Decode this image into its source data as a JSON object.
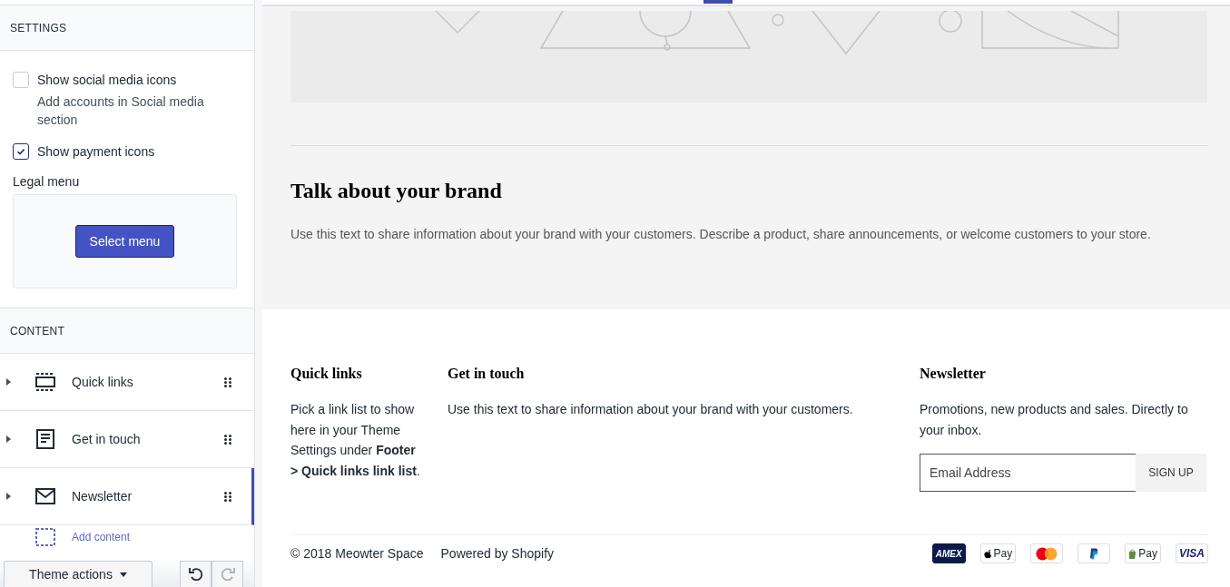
{
  "sidebar": {
    "settings_heading": "SETTINGS",
    "checkboxes": [
      {
        "label": "Show social media icons",
        "checked": false,
        "help": "Add accounts in Social media section"
      },
      {
        "label": "Show payment icons",
        "checked": true
      }
    ],
    "legal_menu": {
      "label": "Legal menu",
      "button": "Select menu"
    },
    "content_heading": "CONTENT",
    "blocks": [
      {
        "kind": "links",
        "label": "Quick links",
        "selected": false
      },
      {
        "kind": "text",
        "label": "Get in touch",
        "selected": false
      },
      {
        "kind": "mail",
        "label": "Newsletter",
        "selected": true
      }
    ],
    "add_content": "Add content",
    "theme_actions": "Theme actions"
  },
  "preview": {
    "heading": "Talk about your brand",
    "text": "Use this text to share information about your brand with your customers. Describe a product, share announcements, or welcome customers to your store.",
    "footer_columns": [
      {
        "title": "Quick links",
        "text": "Pick a link list to show here in your Theme Settings under **Footer > Quick links link list**."
      },
      {
        "title": "Get in touch",
        "text": "Use this text to share information about your brand with your customers."
      }
    ],
    "newsletter": {
      "title": "Newsletter",
      "text": "Promotions, new products and sales. Directly to your inbox.",
      "placeholder": "Email Address",
      "button": "SIGN UP"
    },
    "copyright": "© 2018 Meowter Space",
    "powered": "Powered by Shopify",
    "payment_icons": [
      {
        "kind": "amex",
        "label": "AMEX"
      },
      {
        "kind": "apple",
        "label": "Pay"
      },
      {
        "kind": "mastercard"
      },
      {
        "kind": "paypal"
      },
      {
        "kind": "shop",
        "label": "Pay"
      },
      {
        "kind": "visa",
        "label": "VISA"
      }
    ]
  }
}
